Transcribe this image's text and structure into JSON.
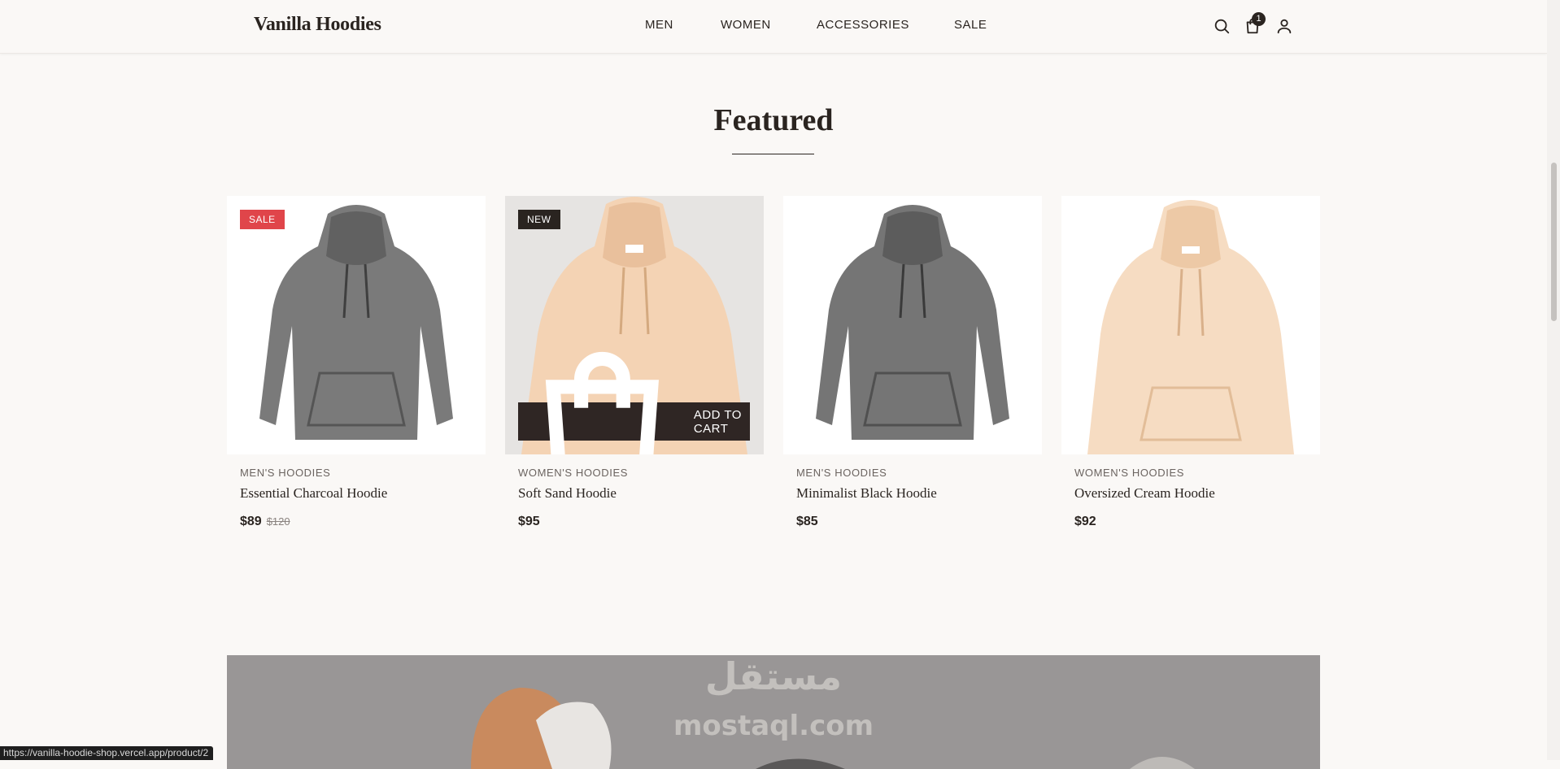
{
  "brand": "Vanilla Hoodies",
  "nav": [
    "MEN",
    "WOMEN",
    "ACCESSORIES",
    "SALE"
  ],
  "header": {
    "cart_count": "1",
    "icons": [
      "search-icon",
      "shopping-bag-icon",
      "user-icon"
    ]
  },
  "section": {
    "title": "Featured"
  },
  "add_to_cart_label": "ADD TO CART",
  "products": [
    {
      "badge": "SALE",
      "category": "MEN'S HOODIES",
      "name": "Essential Charcoal Hoodie",
      "price": "$89",
      "old_price": "$120",
      "color": "charcoal"
    },
    {
      "badge": "NEW",
      "category": "WOMEN'S HOODIES",
      "name": "Soft Sand Hoodie",
      "price": "$95",
      "color": "sand"
    },
    {
      "category": "MEN'S HOODIES",
      "name": "Minimalist Black Hoodie",
      "price": "$85",
      "color": "charcoal"
    },
    {
      "category": "WOMEN'S HOODIES",
      "name": "Oversized Cream Hoodie",
      "price": "$92",
      "color": "cream"
    }
  ],
  "colors": {
    "sale_badge": "#e0454a",
    "dark": "#2a2420",
    "background": "#faf8f6"
  },
  "status_url": "https://vanilla-hoodie-shop.vercel.app/product/2",
  "watermark": {
    "arabic": "مستقل",
    "latin": "mostaql.com"
  }
}
